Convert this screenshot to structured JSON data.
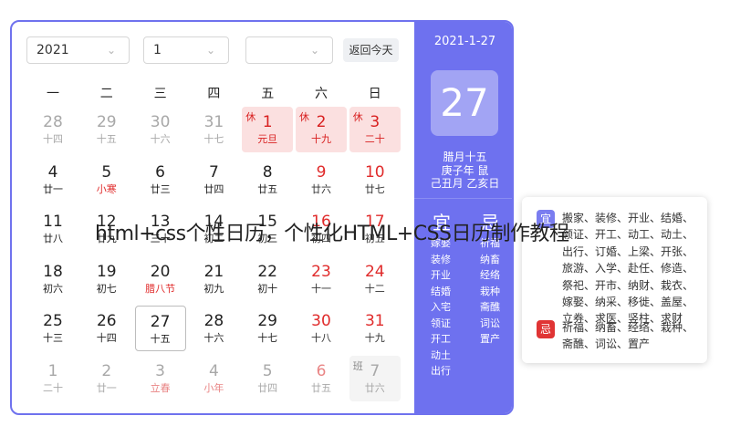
{
  "selects": {
    "year": "2021",
    "month": "1",
    "third": ""
  },
  "today_button": "返回今天",
  "weekdays": [
    "一",
    "二",
    "三",
    "四",
    "五",
    "六",
    "日"
  ],
  "days": [
    [
      {
        "d": "28",
        "l": "十四",
        "t": "other"
      },
      {
        "d": "29",
        "l": "十五",
        "t": "other"
      },
      {
        "d": "30",
        "l": "十六",
        "t": "other"
      },
      {
        "d": "31",
        "l": "十七",
        "t": "other"
      },
      {
        "d": "1",
        "l": "元旦",
        "t": "holiday",
        "tag": "休"
      },
      {
        "d": "2",
        "l": "十九",
        "t": "holiday",
        "tag": "休"
      },
      {
        "d": "3",
        "l": "二十",
        "t": "holiday",
        "tag": "休"
      }
    ],
    [
      {
        "d": "4",
        "l": "廿一",
        "t": "normal"
      },
      {
        "d": "5",
        "l": "小寒",
        "t": "festival"
      },
      {
        "d": "6",
        "l": "廿三",
        "t": "normal"
      },
      {
        "d": "7",
        "l": "廿四",
        "t": "normal"
      },
      {
        "d": "8",
        "l": "廿五",
        "t": "normal"
      },
      {
        "d": "9",
        "l": "廿六",
        "t": "red"
      },
      {
        "d": "10",
        "l": "廿七",
        "t": "red"
      }
    ],
    [
      {
        "d": "11",
        "l": "廿八",
        "t": "normal"
      },
      {
        "d": "12",
        "l": "廿九",
        "t": "normal"
      },
      {
        "d": "13",
        "l": "三十",
        "t": "normal"
      },
      {
        "d": "14",
        "l": "初二",
        "t": "normal"
      },
      {
        "d": "15",
        "l": "初三",
        "t": "normal"
      },
      {
        "d": "16",
        "l": "初四",
        "t": "red"
      },
      {
        "d": "17",
        "l": "初五",
        "t": "red"
      }
    ],
    [
      {
        "d": "18",
        "l": "初六",
        "t": "normal"
      },
      {
        "d": "19",
        "l": "初七",
        "t": "normal"
      },
      {
        "d": "20",
        "l": "腊八节",
        "t": "festival"
      },
      {
        "d": "21",
        "l": "初九",
        "t": "normal"
      },
      {
        "d": "22",
        "l": "初十",
        "t": "normal"
      },
      {
        "d": "23",
        "l": "十一",
        "t": "red"
      },
      {
        "d": "24",
        "l": "十二",
        "t": "red"
      }
    ],
    [
      {
        "d": "25",
        "l": "十三",
        "t": "normal"
      },
      {
        "d": "26",
        "l": "十四",
        "t": "normal"
      },
      {
        "d": "27",
        "l": "十五",
        "t": "today"
      },
      {
        "d": "28",
        "l": "十六",
        "t": "normal"
      },
      {
        "d": "29",
        "l": "十七",
        "t": "normal"
      },
      {
        "d": "30",
        "l": "十八",
        "t": "red"
      },
      {
        "d": "31",
        "l": "十九",
        "t": "red"
      }
    ],
    [
      {
        "d": "1",
        "l": "二十",
        "t": "other"
      },
      {
        "d": "2",
        "l": "廿一",
        "t": "other"
      },
      {
        "d": "3",
        "l": "立春",
        "t": "otherfestival"
      },
      {
        "d": "4",
        "l": "小年",
        "t": "otherfestival"
      },
      {
        "d": "5",
        "l": "廿四",
        "t": "other"
      },
      {
        "d": "6",
        "l": "廿五",
        "t": "otherred"
      },
      {
        "d": "7",
        "l": "廿六",
        "t": "workday",
        "tag": "班"
      }
    ]
  ],
  "right": {
    "date": "2021-1-27",
    "big_day": "27",
    "lunar": "腊月十五",
    "ganzhi_year": "庚子年 鼠",
    "ganzhi_month_day": "己丑月 乙亥日",
    "yi_head": "宜",
    "ji_head": "忌",
    "yi_list": [
      "嫁娶",
      "装修",
      "开业",
      "结婚",
      "入宅",
      "领证",
      "开工",
      "动土",
      "出行"
    ],
    "ji_list": [
      "祈福",
      "纳畜",
      "经络",
      "栽种",
      "斋醮",
      "词讼",
      "置产"
    ]
  },
  "popup": {
    "yi_label": "宜",
    "ji_label": "忌",
    "yi_text": "搬家、装修、开业、结婚、领证、开工、动工、动土、出行、订婚、上梁、开张、旅游、入学、赴任、修造、祭祀、开市、纳财、栽衣、嫁娶、纳采、移徙、盖屋、立券、求医、竖柱、求财",
    "ji_text": "祈福、纳畜、经络、栽种、斋醮、词讼、置产"
  },
  "overlay_title": "html+css个性日历，个性化HTML+CSS日历制作教程",
  "colors": {
    "accent": "#6e71ef",
    "holiday_bg": "#fbe0e0",
    "red": "#e02b2b"
  }
}
